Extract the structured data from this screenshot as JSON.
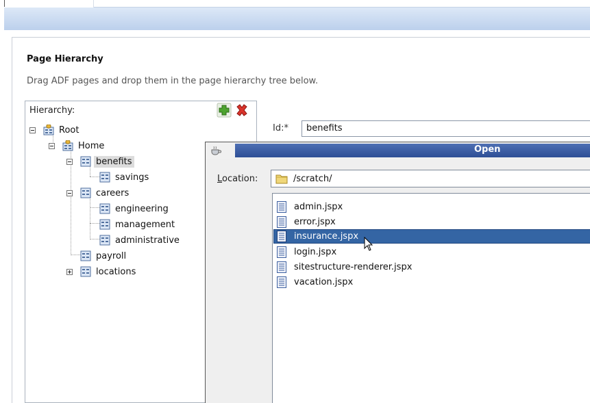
{
  "section": {
    "title": "Page Hierarchy",
    "description": "Drag ADF pages and drop them in the page hierarchy tree below."
  },
  "hierarchy": {
    "label": "Hierarchy:",
    "nodes": [
      {
        "label": "Root"
      },
      {
        "label": "Home"
      },
      {
        "label": "benefits"
      },
      {
        "label": "savings"
      },
      {
        "label": "careers"
      },
      {
        "label": "engineering"
      },
      {
        "label": "management"
      },
      {
        "label": "administrative"
      },
      {
        "label": "payroll"
      },
      {
        "label": "locations"
      }
    ],
    "selected": "benefits"
  },
  "properties": {
    "id_label": "Id:*",
    "id_value": "benefits"
  },
  "open_dialog": {
    "title": "Open",
    "location_label_prefix": "",
    "location_label_mnemonic": "L",
    "location_label_rest": "ocation:",
    "location_value": "/scratch/",
    "files": [
      {
        "name": "admin.jspx"
      },
      {
        "name": "error.jspx"
      },
      {
        "name": "insurance.jspx"
      },
      {
        "name": "login.jspx"
      },
      {
        "name": "sitestructure-renderer.jspx"
      },
      {
        "name": "vacation.jspx"
      }
    ],
    "selected_file": "insurance.jspx"
  },
  "icons": {
    "add": "add-icon",
    "delete": "delete-icon",
    "page": "page-icon",
    "folder": "folder-icon",
    "file": "file-icon",
    "cursor": "mouse-cursor"
  },
  "colors": {
    "titlebar": "#2d4f96",
    "selection": "#3465a4",
    "tree_selection": "#dcdcdc"
  }
}
